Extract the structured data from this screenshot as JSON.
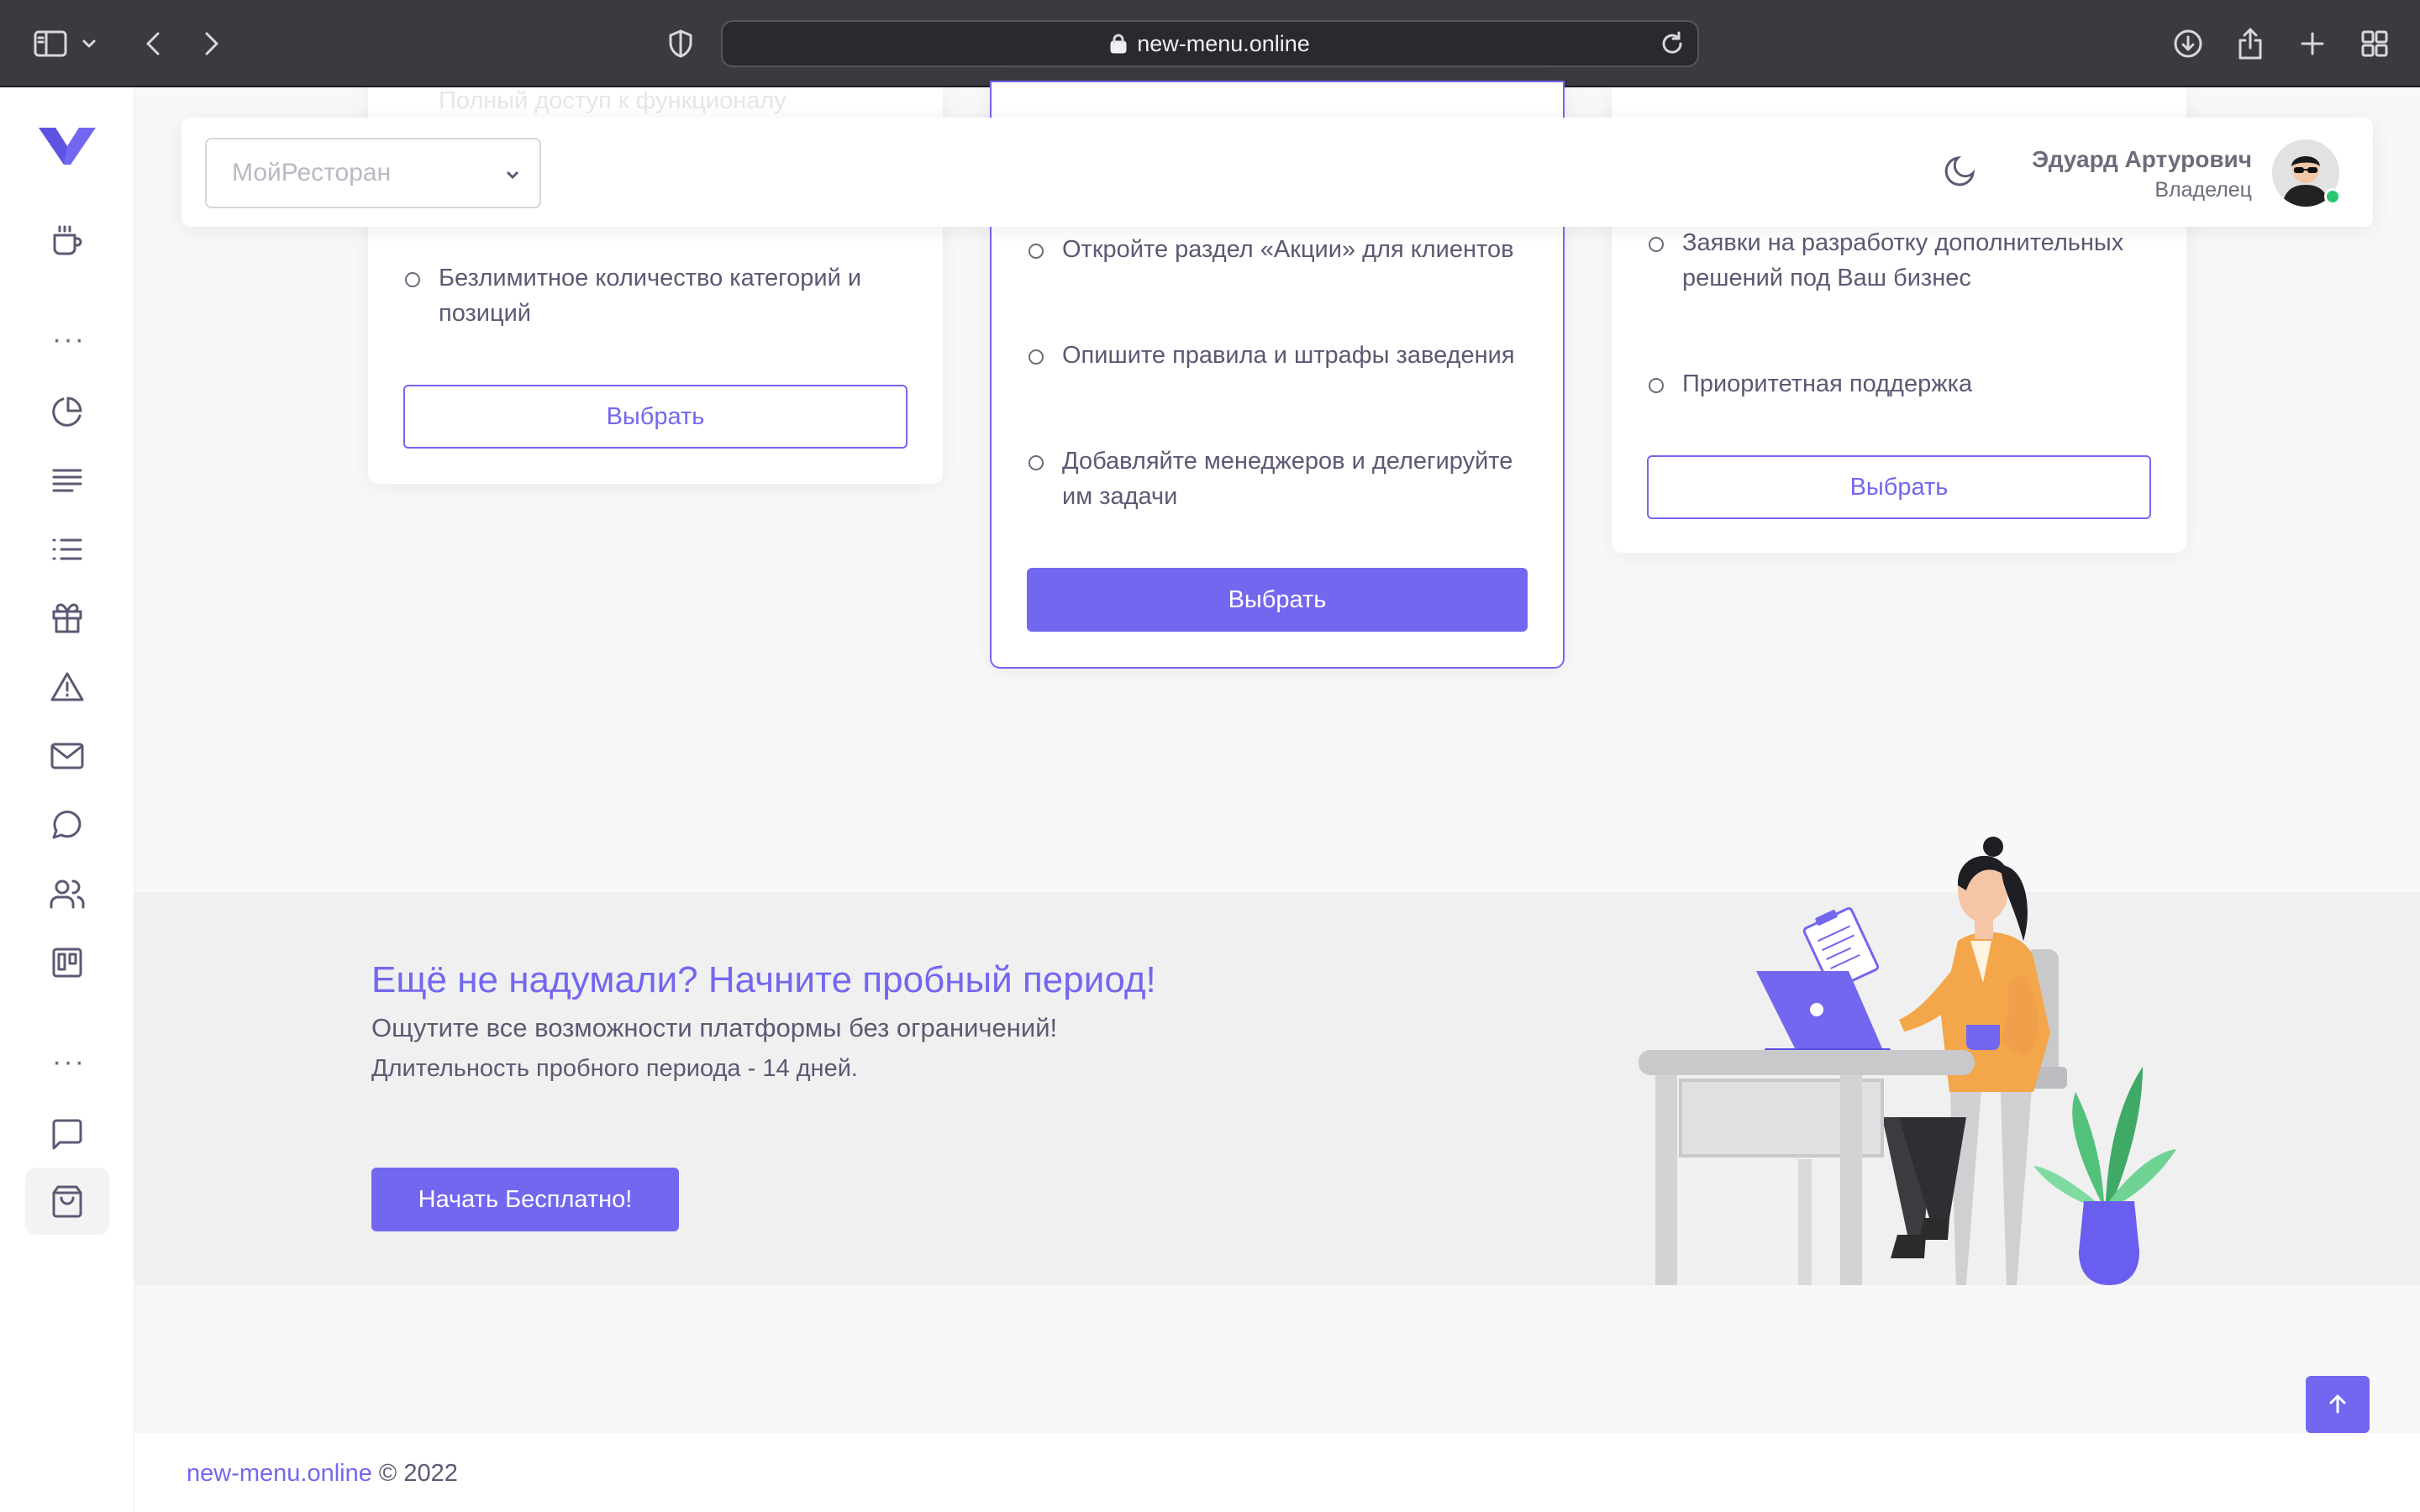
{
  "browser": {
    "url": "new-menu.online"
  },
  "sidebar": {
    "icons": [
      "logo-icon",
      "coffee-cup-icon",
      "more-dots-icon",
      "pie-chart-icon",
      "text-align-icon",
      "list-icon",
      "gift-icon",
      "alert-triangle-icon",
      "mail-icon",
      "message-circle-icon",
      "users-icon",
      "trello-icon",
      "more-dots-icon",
      "message-square-icon",
      "shopping-bag-icon"
    ],
    "active": "shopping-bag-icon"
  },
  "navbar": {
    "restaurant_select": "МойРесторан",
    "user_name": "Эдуард Артурович",
    "user_role": "Владелец"
  },
  "plans": {
    "basic": {
      "faded_feature": "Полный доступ к функционалу",
      "features": [
        "Безлимитное количество категорий и позиций"
      ],
      "button": "Выбрать"
    },
    "standard": {
      "features": [
        "Откройте раздел «Акции» для клиентов",
        "Опишите правила и штрафы заведения",
        "Добавляйте менеджеров и делегируйте им задачи"
      ],
      "button": "Выбрать"
    },
    "premium": {
      "features": [
        "Заявки на разработку дополнительных решений под Ваш бизнес",
        "Приоритетная поддержка"
      ],
      "button": "Выбрать"
    }
  },
  "trial": {
    "title": "Ещё не надумали? Начните пробный период!",
    "subtitle": "Ощутите все возможности платформы без ограничений!",
    "duration": "Длительность пробного периода - 14 дней.",
    "button": "Начать Бесплатно!"
  },
  "footer": {
    "link": "new-menu.online",
    "copyright": "© 2022"
  },
  "colors": {
    "primary": "#7367f0",
    "text": "#5e5873",
    "online": "#28c76f"
  }
}
